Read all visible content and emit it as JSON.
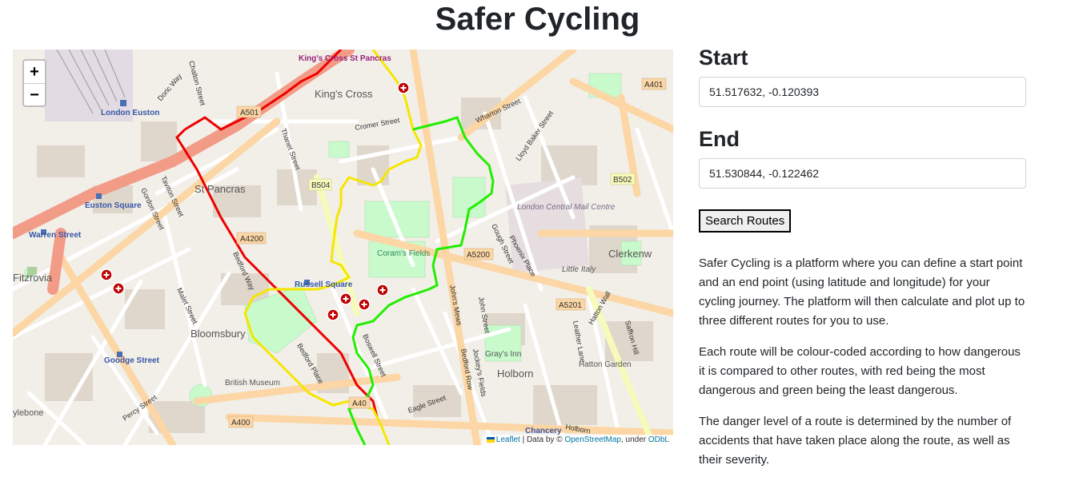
{
  "page": {
    "title": "Safer Cycling"
  },
  "form": {
    "start_label": "Start",
    "start_value": "51.517632, -0.120393",
    "end_label": "End",
    "end_value": "51.530844, -0.122462",
    "search_button": "Search Routes"
  },
  "description": {
    "paragraphs": [
      "Safer Cycling is a platform where you can define a start point and an end point (using latitude and longitude) for your cycling journey. The platform will then calculate and plot up to three different routes for you to use.",
      "Each route will be colour-coded according to how dangerous it is compared to other routes, with red being the most dangerous and green being the least dangerous.",
      "The danger level of a route is determined by the number of accidents that have taken place along the route, as well as their severity."
    ]
  },
  "map": {
    "zoom_in": "+",
    "zoom_out": "−",
    "attribution": {
      "leaflet": "Leaflet",
      "separator": " | Data by © ",
      "osm": "OpenStreetMap",
      "under": ", under ",
      "license": "ODbL"
    },
    "labels": {
      "kings_cross": "King's Cross",
      "kings_cross_st_pancras": "King's Cross St Pancras",
      "london_euston": "London Euston",
      "st_pancras": "St Pancras",
      "euston_square": "Euston Square",
      "warren_street": "Warren Street",
      "fitzrovia": "Fitzrovia",
      "bloomsbury": "Bloomsbury",
      "russell_square": "Russell Square",
      "corams_fields": "Coram's Fields",
      "goodge_street": "Goodge Street",
      "british_museum": "British Museum",
      "holborn": "Holborn",
      "grays_inn": "Gray's Inn",
      "hatton_garden": "Hatton Garden",
      "little_italy": "Little Italy",
      "london_central_mail_centre": "London Central Mail Centre",
      "clerkenwell": "Clerkenw",
      "chancery": "Chancery",
      "a501": "A501",
      "a4200": "A4200",
      "b504": "B504",
      "a5200": "A5200",
      "a5201": "A5201",
      "a401": "A401",
      "b502": "B502",
      "a40": "A40",
      "a400": "A400",
      "cromer_street": "Cromer Street",
      "wharton_street": "Wharton Street",
      "lloyd_baker_street": "Lloyd Baker Street",
      "gough_street": "Gough Street",
      "phoenix_place": "Phoenix Place",
      "john_street": "John Street",
      "boswell_street": "Boswell Street",
      "bedford_place": "Bedford Place",
      "bedford_way": "Bedford Way",
      "gordon_street": "Gordon Street",
      "taviton_street": "Taviton Street",
      "malet_street": "Malet Street",
      "percy_street": "Percy Street",
      "eagle_street": "Eagle Street",
      "hatton_wall": "Hatton Wall",
      "saffron_hill": "Saffron Hill",
      "leather_lane": "Leather Lane",
      "jockeys_fields": "Jockey's Fields",
      "bedford_row": "Bedford Row",
      "johns_mews": "John's Mews",
      "thanet_street": "Thanet Street",
      "chalton_street": "Chalton Street",
      "doric_way": "Doric Way",
      "marylebone": "ylebone",
      "holborn_street": "Holborn"
    }
  },
  "routes": [
    {
      "danger": "most dangerous",
      "color": "#ee0000"
    },
    {
      "danger": "medium",
      "color": "#f5e600"
    },
    {
      "danger": "least dangerous",
      "color": "#22ee00"
    }
  ]
}
